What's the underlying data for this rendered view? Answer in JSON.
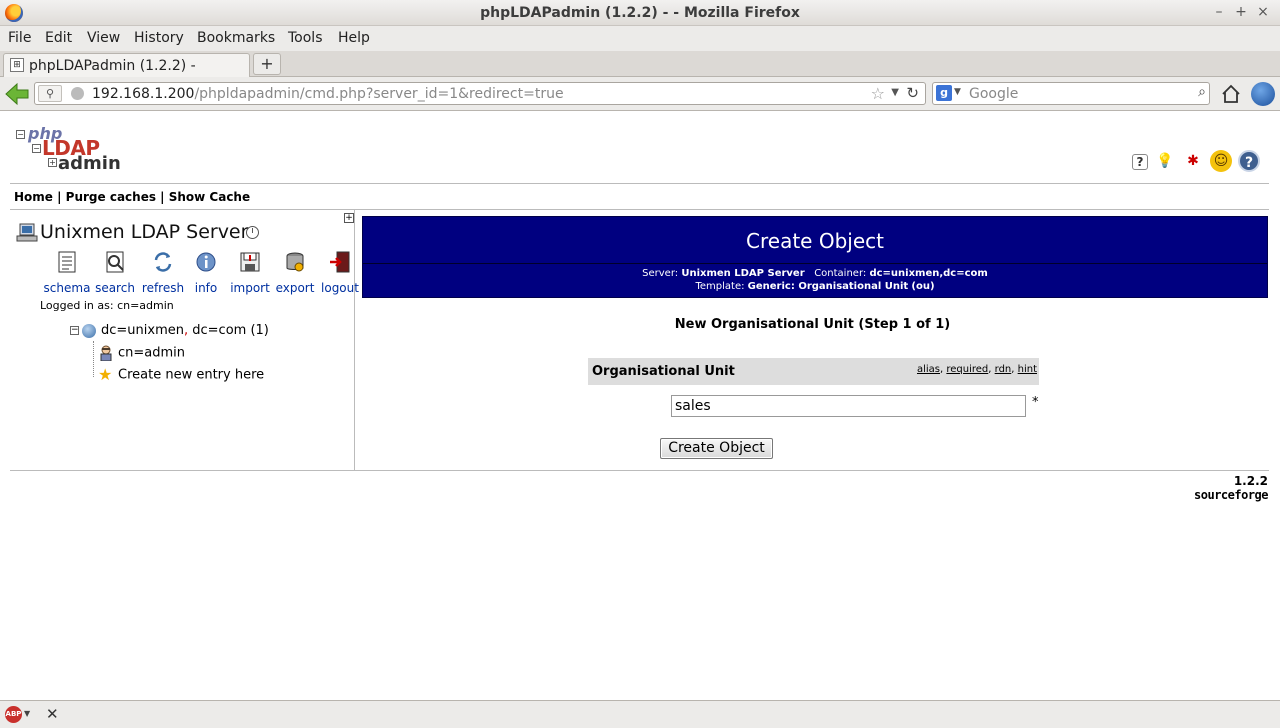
{
  "window": {
    "title": "phpLDAPadmin (1.2.2) - - Mozilla Firefox",
    "controls": [
      "–",
      "+",
      "×"
    ]
  },
  "menu": [
    "File",
    "Edit",
    "View",
    "History",
    "Bookmarks",
    "Tools",
    "Help"
  ],
  "tab": {
    "label": "phpLDAPadmin (1.2.2) -",
    "new_tab": "+"
  },
  "navbar": {
    "url_host": "192.168.1.200",
    "url_path": "/phpldapadmin/cmd.php?server_id=1&redirect=true",
    "search_placeholder": "Google"
  },
  "logo": {
    "php": "php",
    "ldap": "LDAP",
    "admin": "admin"
  },
  "top_links": "Home | Purge caches | Show Cache",
  "server": {
    "name": "Unixmen LDAP Server",
    "actions": [
      "schema",
      "search",
      "refresh",
      "info",
      "import",
      "export",
      "logout"
    ],
    "logged_in": "Logged in as:  cn=admin"
  },
  "tree": {
    "root_prefix": "dc=unixmen",
    "root_sep": ",",
    "root_suffix": " dc=com (1)",
    "child": "cn=admin",
    "create": "Create new entry here"
  },
  "create_object": {
    "title": "Create Object",
    "server_label": "Server:",
    "server_value": "Unixmen LDAP Server",
    "container_label": "Container:",
    "container_value": "dc=unixmen,dc=com",
    "template_label": "Template:",
    "template_value": "Generic: Organisational Unit",
    "template_suffix": "(ou)",
    "step": "New Organisational Unit (Step 1 of 1)",
    "attribute": "Organisational Unit",
    "hints": [
      "alias",
      "required",
      "rdn",
      "hint"
    ],
    "value": "sales",
    "required_mark": "*",
    "button": "Create Object"
  },
  "footer": {
    "version": "1.2.2",
    "sourceforge": "sourceforge"
  },
  "statusbar": {
    "abp": "ABP",
    "close": "✕"
  }
}
